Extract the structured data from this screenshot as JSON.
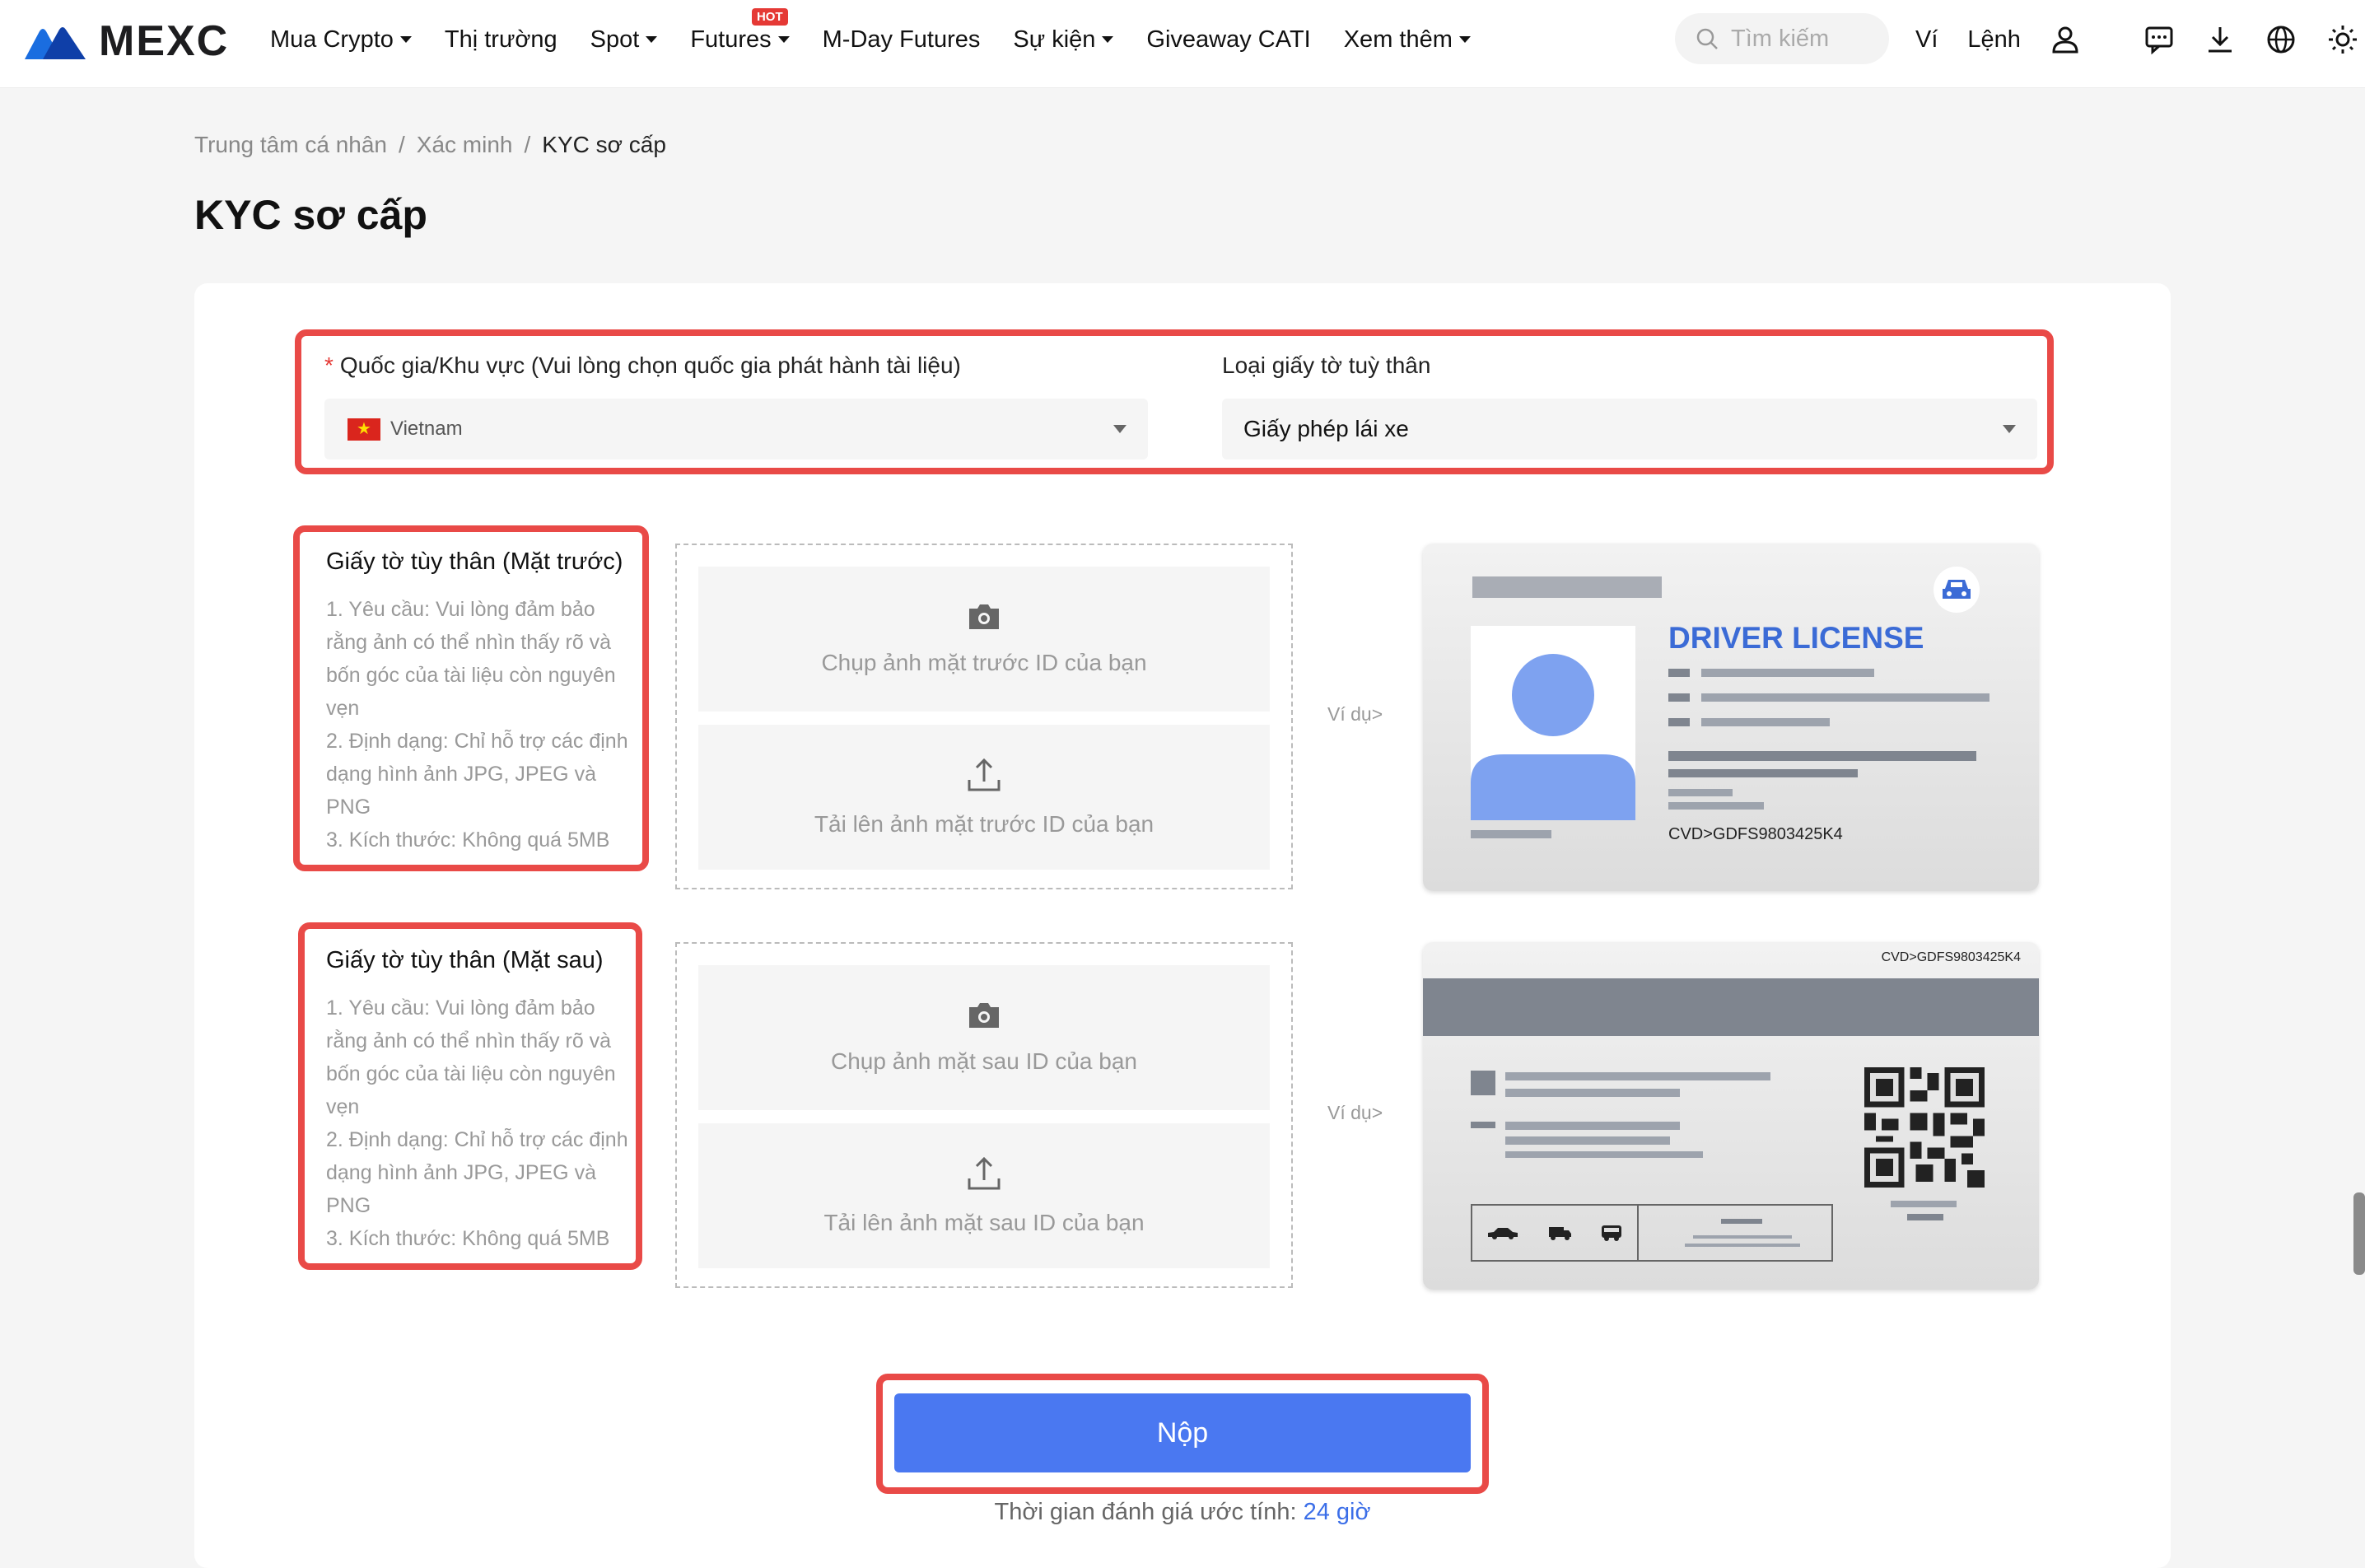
{
  "header": {
    "logo_text": "MEXC",
    "nav": [
      {
        "label": "Mua Crypto",
        "caret": true
      },
      {
        "label": "Thị trường",
        "caret": false
      },
      {
        "label": "Spot",
        "caret": true
      },
      {
        "label": "Futures",
        "caret": true,
        "badge": "HOT"
      },
      {
        "label": "M-Day Futures",
        "caret": false
      },
      {
        "label": "Sự kiện",
        "caret": true
      },
      {
        "label": "Giveaway CATI",
        "caret": false
      },
      {
        "label": "Xem thêm",
        "caret": true
      }
    ],
    "search_placeholder": "Tìm kiếm",
    "wallet": "Ví",
    "orders": "Lệnh",
    "icons": [
      "user-icon",
      "chat-icon",
      "download-icon",
      "globe-icon",
      "sun-icon"
    ]
  },
  "breadcrumb": [
    "Trung tâm cá nhân",
    "Xác minh",
    "KYC sơ cấp"
  ],
  "page_title": "KYC sơ cấp",
  "form": {
    "country_label": "Quốc gia/Khu vực (Vui lòng chọn quốc gia phát hành tài liệu)",
    "country_required": "*",
    "country_value": "Vietnam",
    "doc_type_label": "Loại giấy tờ tuỳ thân",
    "doc_type_value": "Giấy phép lái xe"
  },
  "front": {
    "title": "Giấy tờ tùy thân (Mặt trước)",
    "requirements": "1. Yêu cầu: Vui lòng đảm bảo rằng ảnh có thể nhìn thấy rõ và bốn góc của tài liệu còn nguyên vẹn\n2. Định dạng: Chỉ hỗ trợ các định dạng hình ảnh JPG, JPEG và PNG\n3. Kích thước: Không quá 5MB",
    "capture_label": "Chụp ảnh mặt trước ID của bạn",
    "upload_label": "Tải lên ảnh mặt trước ID của bạn",
    "example_label": "Ví dụ>"
  },
  "back": {
    "title": "Giấy tờ tùy thân (Mặt sau)",
    "requirements": "1. Yêu cầu: Vui lòng đảm bảo rằng ảnh có thể nhìn thấy rõ và bốn góc của tài liệu còn nguyên vẹn\n2. Định dạng: Chỉ hỗ trợ các định dạng hình ảnh JPG, JPEG và PNG\n3. Kích thước: Không quá 5MB",
    "capture_label": "Chụp ảnh mặt sau ID của bạn",
    "upload_label": "Tải lên ảnh mặt sau ID của bạn",
    "example_label": "Ví dụ>"
  },
  "sample_front": {
    "title": "DRIVER LICENSE",
    "code": "CVD>GDFS9803425K4"
  },
  "sample_back": {
    "code": "CVD>GDFS9803425K4"
  },
  "submit_label": "Nộp",
  "eta_prefix": "Thời gian đánh giá ước tính:",
  "eta_value": "24 giờ",
  "colors": {
    "accent": "#4a78f1",
    "highlight": "#e94a47",
    "license_blue": "#3b6bd6"
  }
}
